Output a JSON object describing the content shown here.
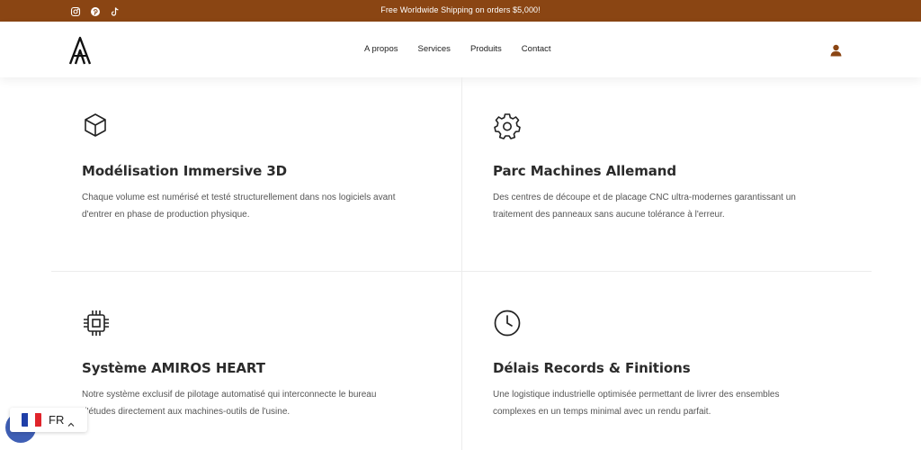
{
  "topbar": {
    "social_icons": [
      "instagram-icon",
      "pinterest-icon",
      "tiktok-icon"
    ],
    "promo_text": "Free Worldwide Shipping on orders $5,000!",
    "background": "#8a4513"
  },
  "header": {
    "logo": "A",
    "nav": [
      "A propos",
      "Services",
      "Produits",
      "Contact"
    ],
    "user_icon": "user-icon",
    "accent": "#8a4513"
  },
  "features": [
    {
      "icon": "cube-icon",
      "title": "Modélisation Immersive 3D",
      "text_line1": "Chaque volume est numérisé et testé structurellement dans nos logiciels avant",
      "text_line2": "d'entrer en phase de production physique."
    },
    {
      "icon": "gear-icon",
      "title": "Parc Machines Allemand",
      "text_line1": "Des centres de découpe et de placage CNC ultra-modernes garantissant un",
      "text_line2": "traitement des panneaux sans aucune tolérance à l'erreur."
    },
    {
      "icon": "cpu-chip-icon",
      "title": "Système AMIROS HEART",
      "text_line1": "Notre système exclusif de pilotage automatisé qui interconnecte le bureau",
      "text_line2": "d'études directement aux machines-outils de l'usine."
    },
    {
      "icon": "clock-icon",
      "title": "Délais Records & Finitions",
      "text_line1": "Une logistique industrielle optimisée permettant de livrer des ensembles",
      "text_line2": "complexes en un temps minimal avec un rendu parfait."
    }
  ],
  "language": {
    "code": "FR",
    "flag_colors": [
      "#1f3fa8",
      "#ffffff",
      "#e0242b"
    ]
  }
}
